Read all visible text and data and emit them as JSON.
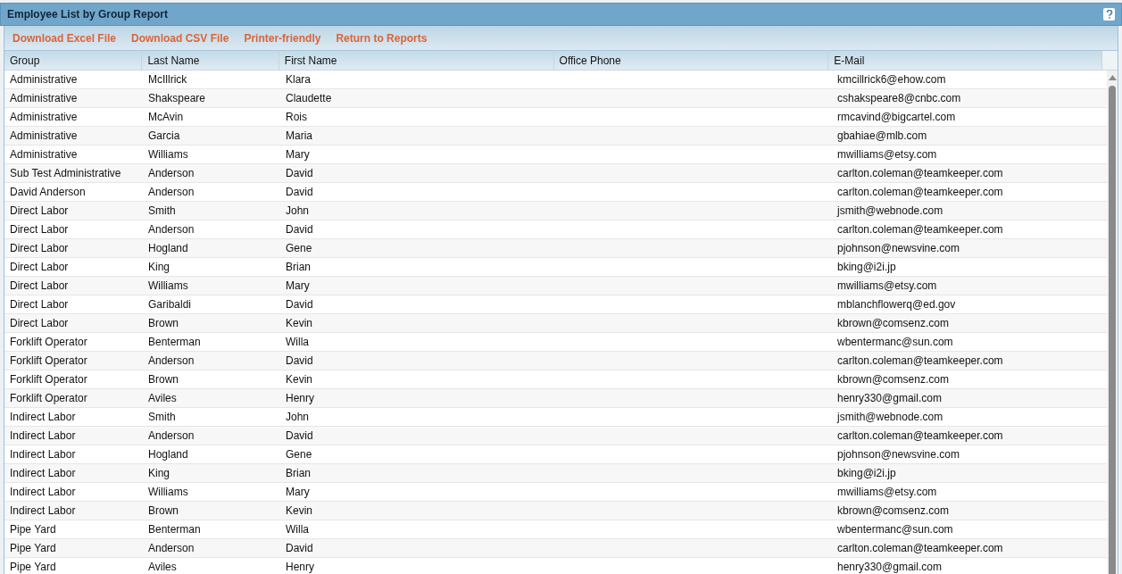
{
  "window": {
    "title": "Employee List by Group Report"
  },
  "toolbar": {
    "links": [
      "Download Excel File",
      "Download CSV File",
      "Printer-friendly",
      "Return to Reports"
    ]
  },
  "table": {
    "columns": [
      "Group",
      "Last Name",
      "First Name",
      "Office Phone",
      "E-Mail"
    ],
    "rows": [
      [
        "Administrative",
        "McIllrick",
        "Klara",
        "",
        "kmcillrick6@ehow.com"
      ],
      [
        "Administrative",
        "Shakspeare",
        "Claudette",
        "",
        "cshakspeare8@cnbc.com"
      ],
      [
        "Administrative",
        "McAvin",
        "Rois",
        "",
        "rmcavind@bigcartel.com"
      ],
      [
        "Administrative",
        "Garcia",
        "Maria",
        "",
        "gbahiae@mlb.com"
      ],
      [
        "Administrative",
        "Williams",
        "Mary",
        "",
        "mwilliams@etsy.com"
      ],
      [
        "Sub Test Administrative",
        "Anderson",
        "David",
        "",
        "carlton.coleman@teamkeeper.com"
      ],
      [
        "David Anderson",
        "Anderson",
        "David",
        "",
        "carlton.coleman@teamkeeper.com"
      ],
      [
        "Direct Labor",
        "Smith",
        "John",
        "",
        "jsmith@webnode.com"
      ],
      [
        "Direct Labor",
        "Anderson",
        "David",
        "",
        "carlton.coleman@teamkeeper.com"
      ],
      [
        "Direct Labor",
        "Hogland",
        "Gene",
        "",
        "pjohnson@newsvine.com"
      ],
      [
        "Direct Labor",
        "King",
        "Brian",
        "",
        "bking@i2i.jp"
      ],
      [
        "Direct Labor",
        "Williams",
        "Mary",
        "",
        "mwilliams@etsy.com"
      ],
      [
        "Direct Labor",
        "Garibaldi",
        "David",
        "",
        "mblanchflowerq@ed.gov"
      ],
      [
        "Direct Labor",
        "Brown",
        "Kevin",
        "",
        "kbrown@comsenz.com"
      ],
      [
        "Forklift Operator",
        "Benterman",
        "Willa",
        "",
        "wbentermanc@sun.com"
      ],
      [
        "Forklift Operator",
        "Anderson",
        "David",
        "",
        "carlton.coleman@teamkeeper.com"
      ],
      [
        "Forklift Operator",
        "Brown",
        "Kevin",
        "",
        "kbrown@comsenz.com"
      ],
      [
        "Forklift Operator",
        "Aviles",
        "Henry",
        "",
        "henry330@gmail.com"
      ],
      [
        "Indirect Labor",
        "Smith",
        "John",
        "",
        "jsmith@webnode.com"
      ],
      [
        "Indirect Labor",
        "Anderson",
        "David",
        "",
        "carlton.coleman@teamkeeper.com"
      ],
      [
        "Indirect Labor",
        "Hogland",
        "Gene",
        "",
        "pjohnson@newsvine.com"
      ],
      [
        "Indirect Labor",
        "King",
        "Brian",
        "",
        "bking@i2i.jp"
      ],
      [
        "Indirect Labor",
        "Williams",
        "Mary",
        "",
        "mwilliams@etsy.com"
      ],
      [
        "Indirect Labor",
        "Brown",
        "Kevin",
        "",
        "kbrown@comsenz.com"
      ],
      [
        "Pipe Yard",
        "Benterman",
        "Willa",
        "",
        "wbentermanc@sun.com"
      ],
      [
        "Pipe Yard",
        "Anderson",
        "David",
        "",
        "carlton.coleman@teamkeeper.com"
      ],
      [
        "Pipe Yard",
        "Aviles",
        "Henry",
        "",
        "henry330@gmail.com"
      ]
    ]
  }
}
